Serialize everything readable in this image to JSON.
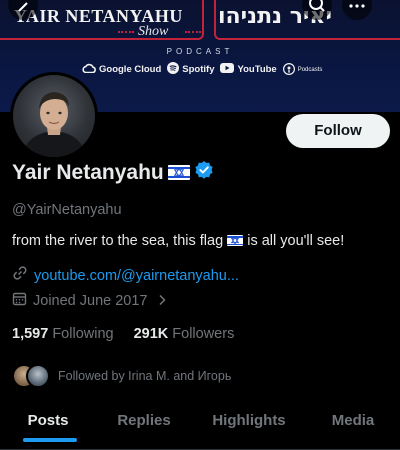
{
  "banner": {
    "title_en": "YAIR NETANYAHU",
    "subtitle_en": "Show",
    "title_he": "יאיר נתניהו",
    "podcast_label": "PODCAST",
    "platforms": [
      {
        "label": "Google Cloud",
        "icon": "google-cloud-icon"
      },
      {
        "label": "Spotify",
        "icon": "spotify-icon"
      },
      {
        "label": "YouTube",
        "icon": "youtube-icon"
      },
      {
        "label": "Podcasts",
        "icon": "apple-podcasts-icon"
      }
    ]
  },
  "profile": {
    "display_name": "Yair Netanyahu",
    "name_flag": "israel-flag-icon",
    "verified": "verified-badge-icon",
    "handle": "@YairNetanyahu",
    "bio_before": "from the river to the sea, this flag ",
    "bio_after": " is all you'll see!",
    "link": "youtube.com/@yairnetanyahu...",
    "joined": "Joined June 2017"
  },
  "actions": {
    "follow_label": "Follow"
  },
  "stats": {
    "following_count": "1,597",
    "following_label": "Following",
    "followers_count": "291K",
    "followers_label": "Followers"
  },
  "followed_by": "Followed by Irina M. and Игорь",
  "tabs": [
    {
      "label": "Posts",
      "active": true
    },
    {
      "label": "Replies",
      "active": false
    },
    {
      "label": "Highlights",
      "active": false
    },
    {
      "label": "Media",
      "active": false
    }
  ],
  "colors": {
    "accent": "#1d9bf0",
    "banner_red": "#c0233a",
    "background": "#000000",
    "muted_text": "#71767b"
  }
}
